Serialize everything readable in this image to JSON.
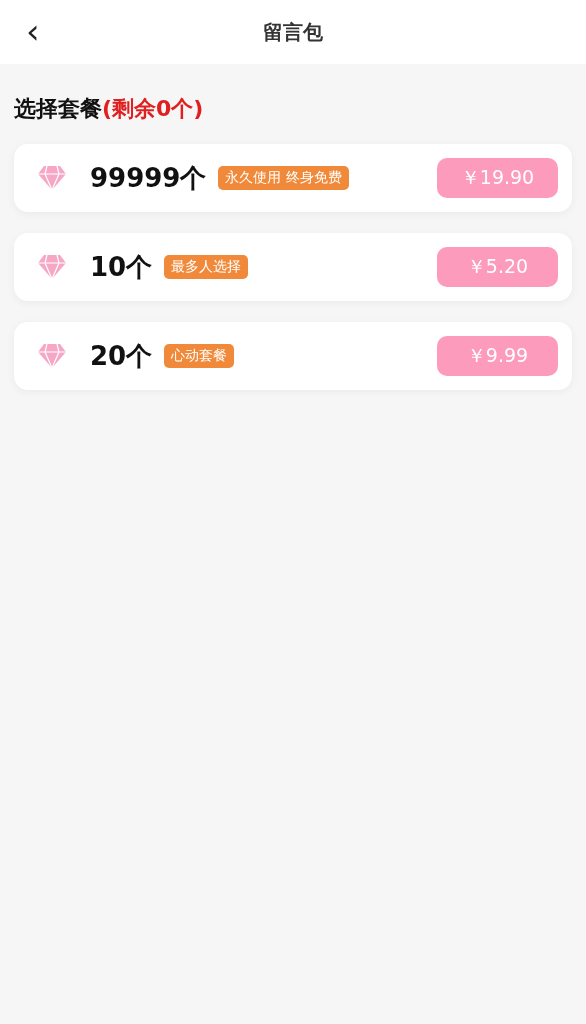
{
  "header": {
    "back_icon": "‹",
    "title": "留言包"
  },
  "section": {
    "title": "选择套餐",
    "remaining": "(剩余0个)"
  },
  "packages": [
    {
      "amount": "99999个",
      "tag": "永久使用 终身免费",
      "price": "￥19.90"
    },
    {
      "amount": "10个",
      "tag": "最多人选择",
      "price": "￥5.20"
    },
    {
      "amount": "20个",
      "tag": "心动套餐",
      "price": "￥9.99"
    }
  ]
}
